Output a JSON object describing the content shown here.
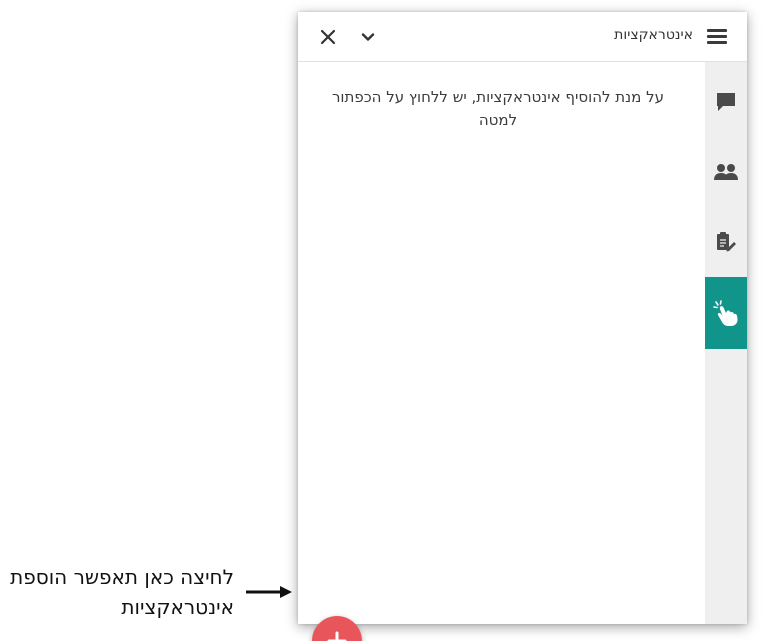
{
  "panel": {
    "title": "אינטראקציות",
    "menu_icon": "hamburger-menu-icon",
    "close_icon": "close-icon",
    "collapse_icon": "chevron-down-icon"
  },
  "content": {
    "empty_message": "על מנת להוסיף אינטראקציות, יש ללחוץ על הכפתור למטה"
  },
  "side_rail": {
    "items": [
      {
        "icon": "chat-icon",
        "active": false
      },
      {
        "icon": "people-icon",
        "active": false
      },
      {
        "icon": "notes-edit-icon",
        "active": false
      },
      {
        "icon": "touch-interaction-icon",
        "active": true
      }
    ],
    "active_color": "#11948a"
  },
  "fab": {
    "icon": "plus-icon",
    "color": "#e8555b"
  },
  "callout": {
    "text": "לחיצה כאן תאפשר הוספת אינטראקציות",
    "arrow_icon": "arrow-right-icon"
  }
}
